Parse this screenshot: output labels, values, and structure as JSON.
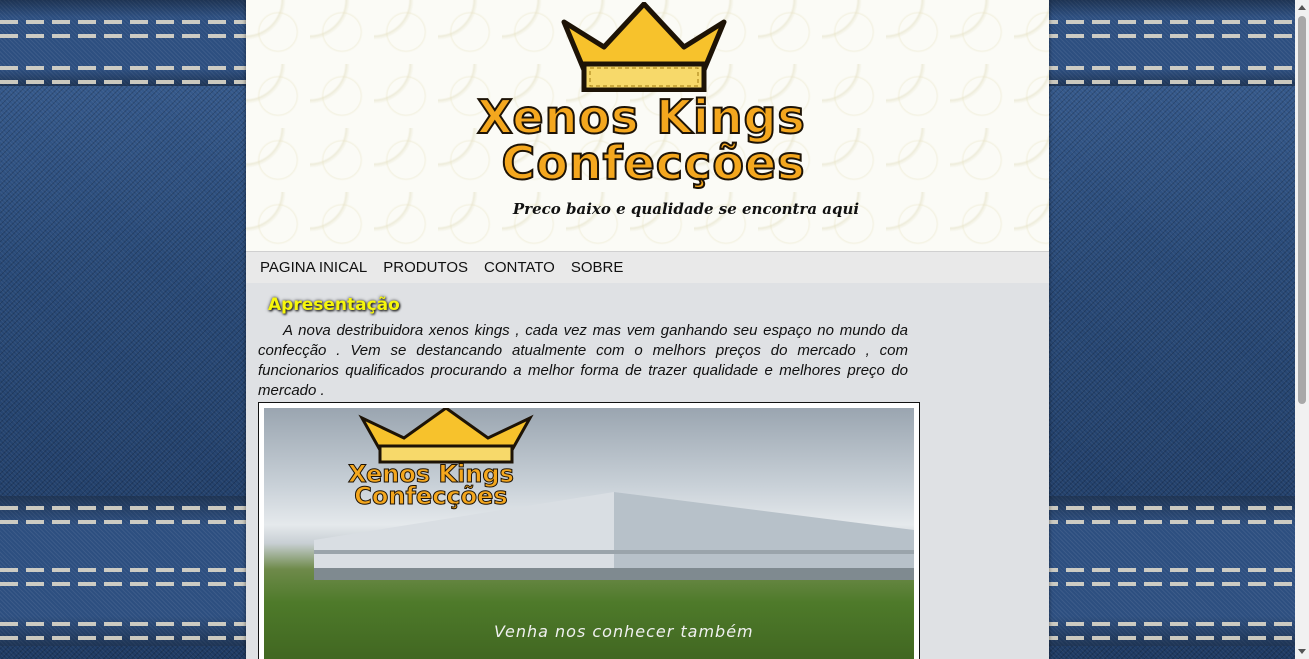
{
  "header": {
    "brand_line1": "Xenos Kings",
    "brand_line2": "Confecções",
    "tagline": "Preco baixo e qualidade se encontra aqui"
  },
  "nav": {
    "items": [
      {
        "label": "PAGINA INICAL"
      },
      {
        "label": "PRODUTOS"
      },
      {
        "label": "CONTATO"
      },
      {
        "label": "SOBRE"
      }
    ]
  },
  "main": {
    "section_title": "Apresentação",
    "intro_text": "A nova destribuidora xenos kings , cada vez mas vem ganhando seu espaço no mundo da confecção . Vem se destancando atualmente com o melhors preços do mercado , com funcionarios qualificados procurando a melhor forma de trazer qualidade e melhores preço do mercado .",
    "photo": {
      "logo_line1": "Xenos Kings",
      "logo_line2": "Confecções",
      "caption": "Venha nos conhecer também"
    }
  },
  "colors": {
    "brand_orange": "#f4a71e",
    "title_yellow": "#f6f60c",
    "denim_blue": "#2d4f80"
  }
}
